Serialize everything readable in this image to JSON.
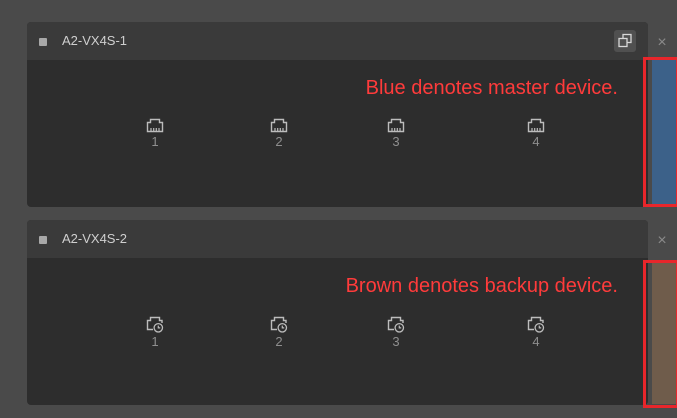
{
  "devices": [
    {
      "name": "A2-VX4S-1",
      "annotation": "Blue denotes master device.",
      "role_color": "#3c6189",
      "port_icon": "ethernet-port-icon",
      "ports": [
        "1",
        "2",
        "3",
        "4"
      ]
    },
    {
      "name": "A2-VX4S-2",
      "annotation": "Brown denotes backup device.",
      "role_color": "#6f5c4b",
      "port_icon": "ethernet-port-backup-icon",
      "ports": [
        "1",
        "2",
        "3",
        "4"
      ]
    }
  ],
  "colors": {
    "highlight": "#e8262b",
    "annotation": "#ff3b3b",
    "panel": "#2d2d2d",
    "header": "#3a3a3a"
  },
  "icons": {
    "header_button": "copy-windows-icon",
    "close": "close-icon"
  },
  "close_symbol": "×"
}
